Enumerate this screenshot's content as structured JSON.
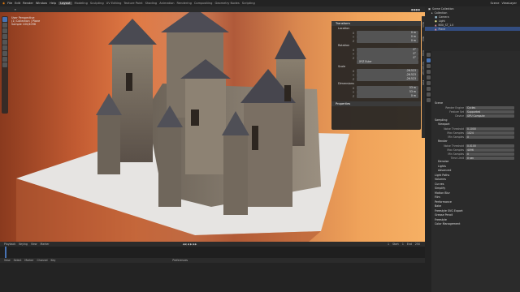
{
  "menu": {
    "items": [
      "File",
      "Edit",
      "Render",
      "Window",
      "Help"
    ],
    "workspaces": [
      "Layout",
      "Modeling",
      "Sculpting",
      "UV Editing",
      "Texture Paint",
      "Shading",
      "Animation",
      "Rendering",
      "Compositing",
      "Geometry Nodes",
      "Scripting"
    ],
    "active_workspace": "Layout"
  },
  "right_header": {
    "scene": "Scene",
    "view_layer": "ViewLayer"
  },
  "viewport_info": {
    "line1": "User Perspective",
    "line2": "(1) Collection | Plane",
    "line3": "Sample 100/4096"
  },
  "npanel": {
    "transform_title": "Transform",
    "location_label": "Location",
    "location": {
      "x": "0 m",
      "y": "0 m",
      "z": "0 m"
    },
    "rotation_label": "Rotation",
    "rotation": {
      "x": "0°",
      "y": "0°",
      "z": "0°"
    },
    "rotation_mode": "XYZ Euler",
    "scale_label": "Scale",
    "scale": {
      "x": "-26.523",
      "y": "-26.523",
      "z": "-26.523"
    },
    "dimensions_label": "Dimensions",
    "dimensions": {
      "x": "53 m",
      "y": "53 m",
      "z": "0 m"
    },
    "properties_title": "Properties",
    "tabs": [
      "Item",
      "Tool",
      "View",
      "Screencast",
      "Edit"
    ]
  },
  "outliner": {
    "title": "Scene Collection",
    "items": [
      {
        "label": "Collection",
        "selected": false
      },
      {
        "label": "Camera",
        "selected": false
      },
      {
        "label": "Light",
        "selected": false
      },
      {
        "label": "BOX_ST_1.0",
        "selected": false
      },
      {
        "label": "Plane",
        "selected": true
      }
    ]
  },
  "properties": {
    "scene_name": "Scene",
    "render_engine_label": "Render Engine",
    "render_engine": "Cycles",
    "feature_set_label": "Feature Set",
    "feature_set": "Supported",
    "device_label": "Device",
    "device": "GPU Compute",
    "sections": [
      "Sampling",
      "Viewport",
      "Render",
      "Denoise",
      "Lights",
      "Advanced",
      "Light Paths",
      "Volumes",
      "Curves",
      "Simplify",
      "Motion Blur",
      "Film",
      "Performance",
      "Bake",
      "Freestyle SVG Export",
      "Grease Pencil",
      "Freestyle",
      "Color Management"
    ],
    "viewport": {
      "noise_threshold_label": "Noise Threshold",
      "noise_threshold": "0.1000",
      "max_samples_label": "Max Samples",
      "max_samples": "1024",
      "min_samples_label": "Min Samples",
      "min_samples": "0"
    },
    "render": {
      "noise_threshold_label": "Noise Threshold",
      "noise_threshold": "0.0100",
      "max_samples_label": "Max Samples",
      "max_samples": "4096",
      "min_samples_label": "Min Samples",
      "min_samples": "0",
      "time_limit_label": "Time Limit",
      "time_limit": "0 sec"
    }
  },
  "timeline": {
    "menu": [
      "Playback",
      "Keying",
      "View",
      "Marker"
    ],
    "start_label": "Start",
    "start": "1",
    "end_label": "End",
    "end": "250",
    "current_frame": "1"
  },
  "editor": {
    "menu": [
      "View",
      "Select",
      "Marker",
      "Channel",
      "Key"
    ],
    "title": "Preferences"
  }
}
